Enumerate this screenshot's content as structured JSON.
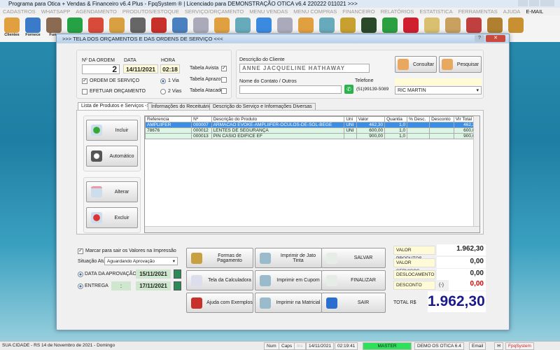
{
  "window": {
    "title": "Programa para Otica + Vendas & Financeiro v6.4 Plus - FpqSystem ® | Licenciado para  DEMONSTRAÇÃO OTICA v6.4 220222 011021 >>>"
  },
  "menu": [
    "CADASTROS",
    "WHATSAPP",
    "AGENDAMENTO",
    "PRODUTOS/ESTOQUE",
    "SERVIÇO/ORÇAMENTO",
    "MENU VENDAS",
    "MENU COMPRAS",
    "FINANCEIRO",
    "RELATÓRIOS",
    "ESTATISTICA",
    "FERRAMENTAS",
    "AJUDA",
    "E-MAIL"
  ],
  "toolbar": {
    "labels": [
      "Clientes",
      "Fornece",
      "Func"
    ],
    "icons": [
      "clients-icon",
      "suppliers-icon",
      "employees-icon",
      "whatsapp-icon",
      "calendar-icon",
      "boxes-icon",
      "barcode-icon",
      "help-icon",
      "clipboard-icon",
      "search-doc-icon",
      "folder-icon",
      "disc-icon",
      "monitor-icon",
      "search-doc-icon",
      "folder-icon",
      "disc-icon",
      "money-chart-icon",
      "cash-icon",
      "dollar-green-icon",
      "dollar-red-icon",
      "tag-icon",
      "scroll-icon",
      "user-icon",
      "coin-icon",
      "exit-icon"
    ]
  },
  "dialog": {
    "title": ">>> TELA DOS ORÇAMENTOS E DAS ORDENS DE SERVIÇO <<<",
    "order_label": "Nº DA ORDEM",
    "order": "2",
    "date_label": "DATA",
    "date": "14/11/2021",
    "time_label": "HORA",
    "time": "02:18",
    "os_label": "ORDEM DE SERVIÇO",
    "orc_label": "EFETUAR ORÇAMENTO",
    "via1": "1 Via",
    "via2": "2 Vias",
    "tab_avista": "Tabela Avista",
    "tab_aprazo": "Tabela Aprazo",
    "tab_atacado": "Tabela Atacado",
    "client_label": "Descrição do Cliente",
    "client": "ANNE JACQUELINE HATHAWAY",
    "contact_label": "Nome do Contato / Outros",
    "contact": "",
    "phone_label": "Telefone",
    "phone": "(51)99139-5089",
    "seller": "RIC MARTIN",
    "consultar": "Consultar",
    "pesquisar": "Pesquisar",
    "tabs": [
      "Lista de Produtos e Serviços ->",
      "Informações do Receituário ->",
      "Descrição do Serviço e Informações Diversas"
    ],
    "side_buttons": [
      "Incluir",
      "Automático",
      "Alterar",
      "Excluir"
    ],
    "columns": [
      "Referencia",
      "Nº",
      "Descrição do Produto",
      "Uni",
      "Valor",
      "Quantia",
      "% Desc.",
      "Desconto",
      "Vlr Total"
    ],
    "rows": [
      [
        "AMPLIIFER",
        "000007",
        "ARMACAO EVOKE-AMPLIIFER-OCULOS-DE-SOL-BEGE",
        "UNI",
        "462,30",
        "1,0",
        "",
        "",
        "462,30"
      ],
      [
        "78676",
        "000012",
        "LENTES DE SEGURANÇA",
        "UNI",
        "600,00",
        "1,0",
        "",
        "",
        "600,00"
      ],
      [
        "",
        "000013",
        "PIN CASIO EDIFICE EF",
        "",
        "900,00",
        "1,0",
        "",
        "",
        "900,00"
      ]
    ],
    "mark_label": "Marcar para sair os Valores na Impressão",
    "situation_label": "Situação Atual",
    "situation": "Aguardando Aprovação",
    "approval_label": "DATA DA APROVAÇÃO",
    "approval": "15/11/2021",
    "delivery_label": "ENTREGA",
    "delivery_time": ":",
    "delivery": "17/11/2021",
    "buttons": [
      "Formas de Pagamento",
      "Imprimir de Jato Tinta",
      "SALVAR",
      "Tela da Calculadora",
      "Imprimir em Cupom",
      "FINALIZAR",
      "Ajuda com Exemplos",
      "Imprimir na Matricial",
      "SAIR"
    ],
    "totals": {
      "produtos_label": "VALOR PRODUTOS",
      "produtos": "1.962,30",
      "servicos_label": "VALOR SERVICOS",
      "servicos": "0,00",
      "desloc_label": "DESLOCAMENTO",
      "desloc": "0,00",
      "desconto_label": "DESCONTO",
      "desconto_sign": "(-)",
      "desconto": "0,00",
      "total_label": "TOTAL R$",
      "total": "1.962,30"
    }
  },
  "status": {
    "left": "SUA CIDADE - RS 14 de Novembro de 2021 - Domingo",
    "num": "Num",
    "caps": "Caps",
    "ins": "Ins",
    "date": "14/11/2021",
    "time": "02:19:41",
    "user": "MASTER",
    "demo": "DEMO OS OTICA 6.4",
    "email": "Email",
    "brand": "FpqSystem"
  }
}
